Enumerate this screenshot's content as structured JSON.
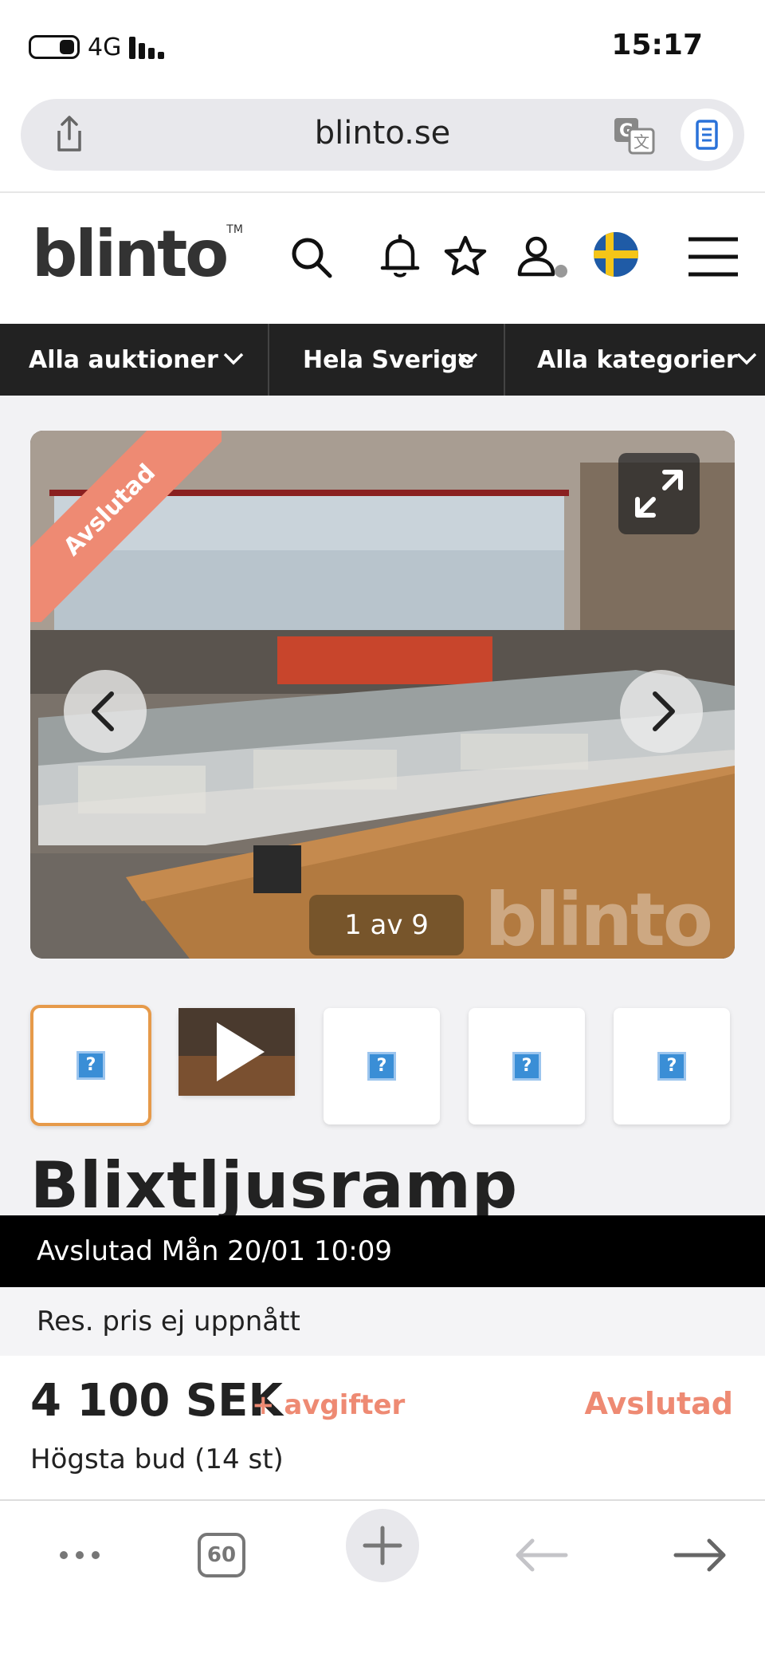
{
  "status_bar": {
    "network": "4G",
    "time": "15:17"
  },
  "browser": {
    "url": "blinto.se"
  },
  "site": {
    "logo": "blinto",
    "logo_tm": "TM",
    "icons": [
      "search-icon",
      "bell-icon",
      "star-icon",
      "user-icon",
      "sweden-flag-icon",
      "menu-icon"
    ]
  },
  "category_nav": [
    {
      "label": "Alla auktioner"
    },
    {
      "label": "Hela Sverige"
    },
    {
      "label": "Alla kategorier"
    }
  ],
  "gallery": {
    "ribbon": "Avslutad",
    "counter": "1 av 9",
    "watermark": "blinto",
    "thumbnails": [
      "placeholder",
      "video",
      "placeholder",
      "placeholder",
      "placeholder"
    ]
  },
  "product": {
    "title": "Blixtljusramp",
    "ended_text": "Avslutad Mån 20/01 10:09",
    "reserve_text": "Res. pris ej uppnått",
    "price": "4 100 SEK",
    "fees": "+ avgifter",
    "status": "Avslutad",
    "bid_info": "Högsta bud (14 st)"
  },
  "bottom_bar": {
    "tab_count": "60"
  },
  "colors": {
    "accent": "#ee8a73",
    "nav_bg": "#222222",
    "thumb_selected": "#e69a4a"
  }
}
